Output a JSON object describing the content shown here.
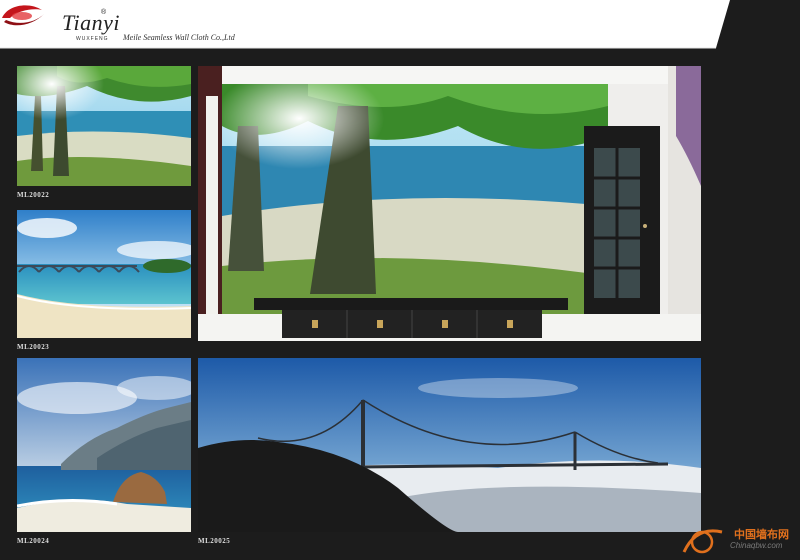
{
  "header": {
    "brand": "Tianyi",
    "brand_sub": "WUXFENG",
    "registered": "®",
    "company": "Meile Seamless Wall Cloth Co.,Ltd"
  },
  "panels": [
    {
      "code": "ML20022"
    },
    {
      "code": "ML20023"
    },
    {
      "code": "ML20024"
    },
    {
      "code": "ML20025"
    }
  ],
  "watermark": {
    "cn": "中国墙布网",
    "en": "Chinaqbw.com"
  },
  "colors": {
    "background": "#1c1c1c",
    "header_band": "#ffffff",
    "logo_red": "#c4161c",
    "watermark_orange": "#e0701d"
  }
}
